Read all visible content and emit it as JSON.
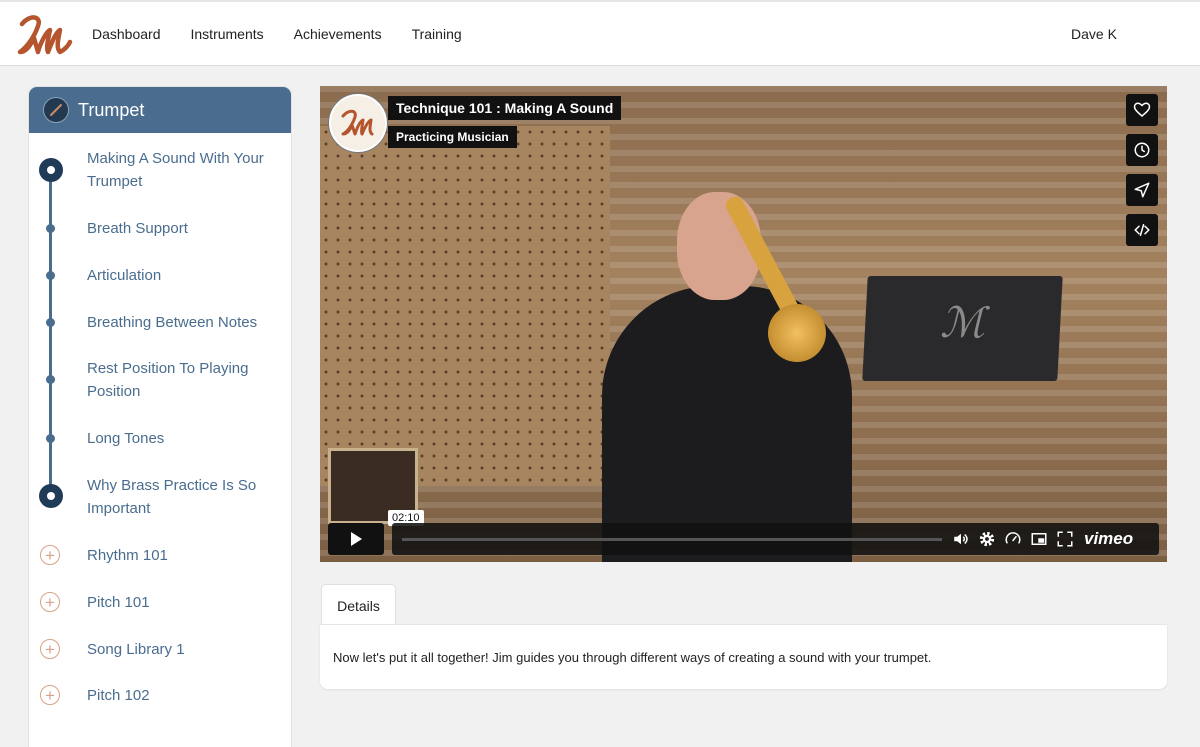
{
  "nav": {
    "items": [
      "Dashboard",
      "Instruments",
      "Achievements",
      "Training"
    ],
    "user": "Dave K"
  },
  "sidebar": {
    "title": "Trumpet",
    "lessons": [
      {
        "label": "Making A Sound With Your Trumpet",
        "state": "current"
      },
      {
        "label": "Breath Support",
        "state": "step"
      },
      {
        "label": "Articulation",
        "state": "step"
      },
      {
        "label": "Breathing Between Notes",
        "state": "step"
      },
      {
        "label": "Rest Position To Playing Position",
        "state": "step"
      },
      {
        "label": "Long Tones",
        "state": "step"
      },
      {
        "label": "Why Brass Practice Is So Important",
        "state": "milestone"
      }
    ],
    "courses": [
      "Rhythm 101",
      "Pitch 101",
      "Song Library 1",
      "Pitch 102"
    ]
  },
  "video": {
    "title": "Technique 101 : Making A Sound",
    "channel": "Practicing Musician",
    "hover_time": "02:10",
    "brand": "vimeo",
    "side_buttons": [
      "heart-icon",
      "clock-icon",
      "send-icon",
      "embed-icon"
    ]
  },
  "details": {
    "tab_label": "Details",
    "text": "Now let's put it all together! Jim guides you through different ways of creating a sound with your trumpet."
  },
  "colors": {
    "accent": "#4a6d8f",
    "brand": "#b4552d",
    "course_plus": "#d9a187"
  }
}
